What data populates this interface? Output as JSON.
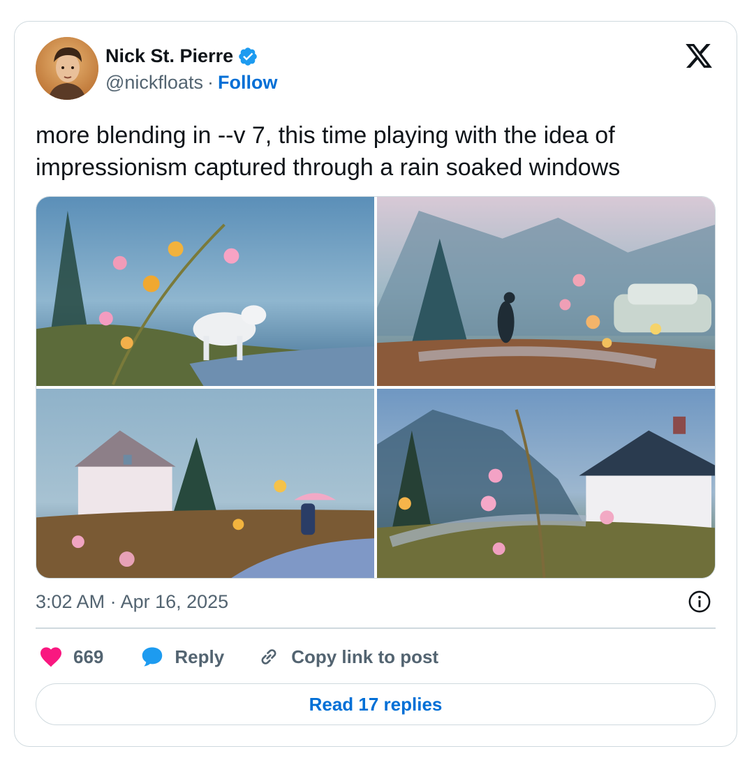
{
  "author": {
    "name": "Nick St. Pierre",
    "handle": "@nickfloats",
    "separator": "·",
    "follow_label": "Follow"
  },
  "tweet": {
    "text": "more blending in --v 7, this time playing with the idea of impressionism captured through a rain soaked windows",
    "timestamp": "3:02 AM · Apr 16, 2025"
  },
  "media": [
    {
      "description": "painting-rain-window-white-horse-flowers"
    },
    {
      "description": "painting-rain-window-figure-walking-car"
    },
    {
      "description": "painting-rain-window-white-house-umbrella"
    },
    {
      "description": "painting-rain-window-white-house-flowers"
    }
  ],
  "actions": {
    "likes_count": "669",
    "reply_label": "Reply",
    "copy_label": "Copy link to post"
  },
  "read_replies_label": "Read 17 replies",
  "colors": {
    "link_blue": "#006fd6",
    "verified_blue": "#1d9bf0",
    "heart_pink": "#f91880",
    "reply_blue": "#1d9bf0",
    "muted_text": "#536471",
    "border": "#cfd9de"
  },
  "icons": [
    "x-logo-icon",
    "verified-badge-icon",
    "info-icon",
    "heart-icon",
    "reply-bubble-icon",
    "link-icon"
  ]
}
